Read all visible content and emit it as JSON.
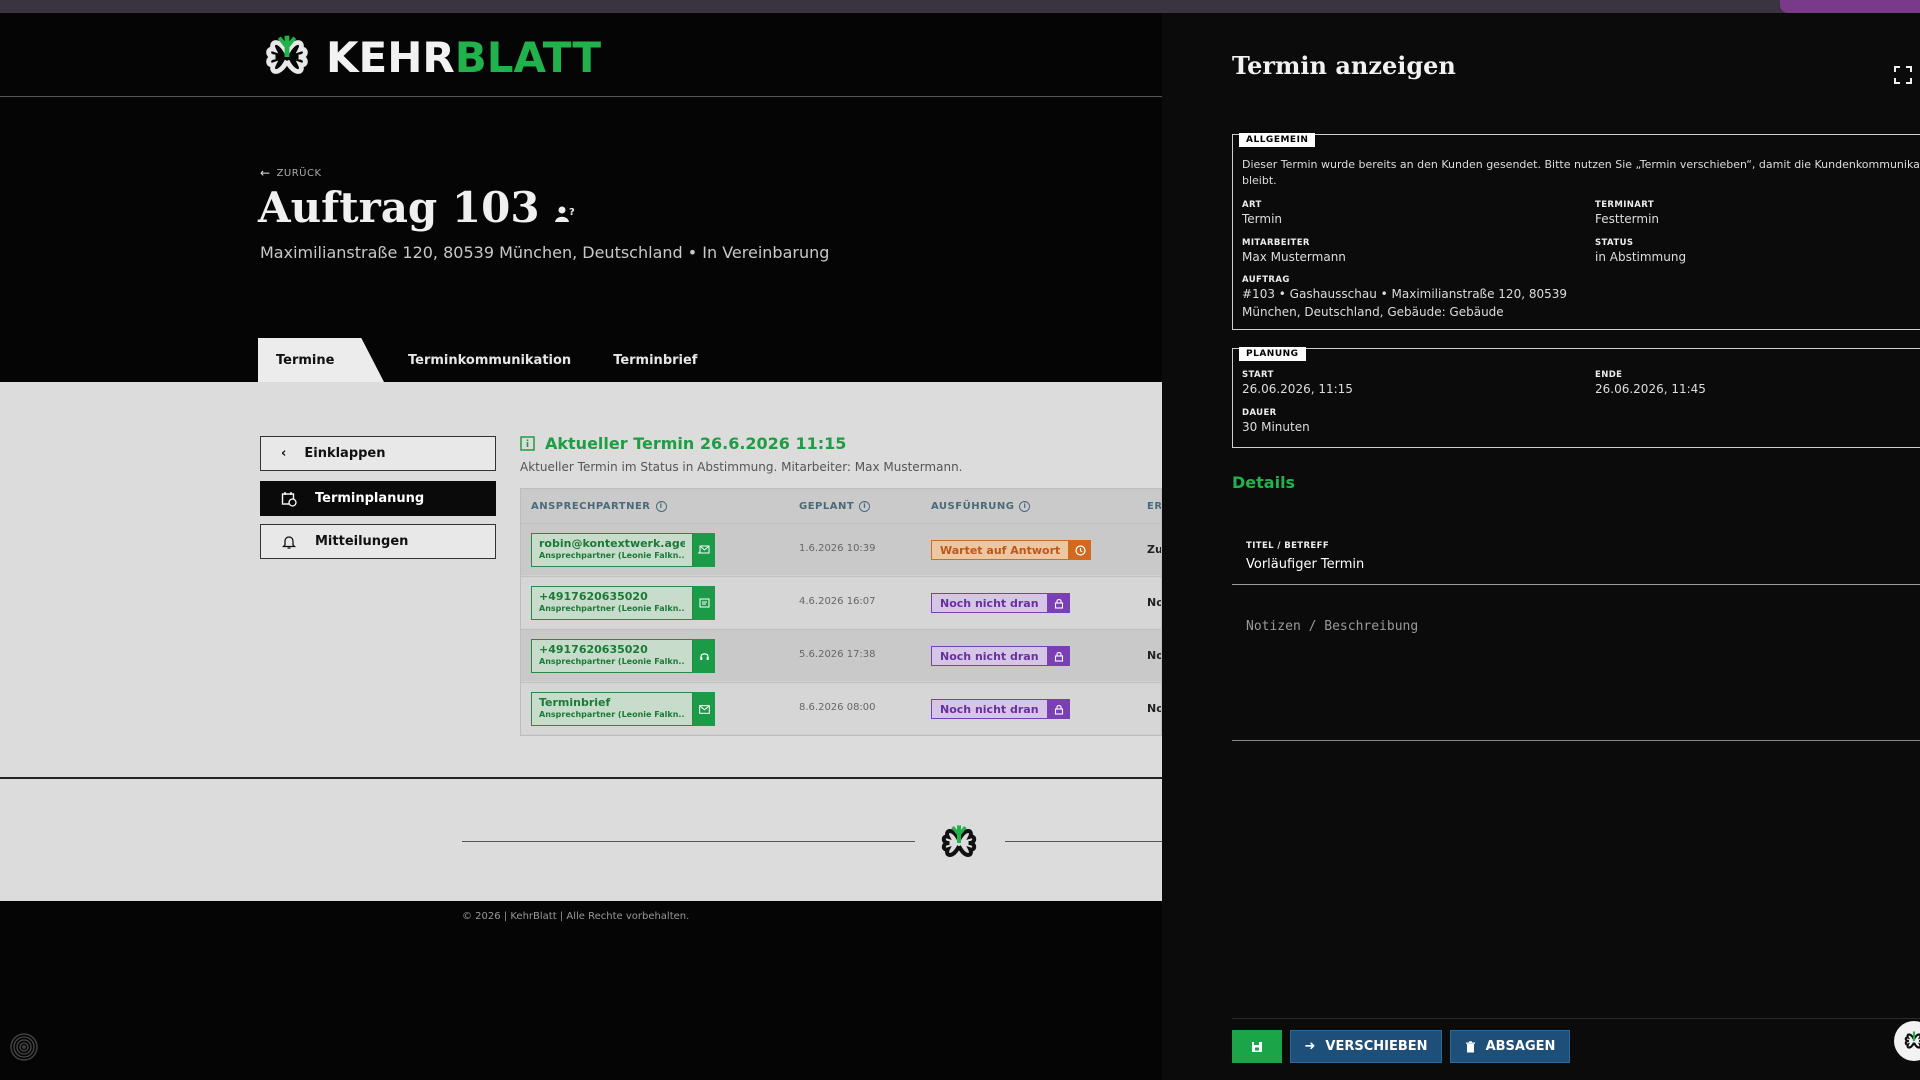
{
  "brand": {
    "name_part1": "KEHR",
    "name_part2": "BLATT",
    "color_light": "#f2f2f2",
    "color_green": "#22b24c"
  },
  "page": {
    "back_label": "ZURÜCK",
    "title": "Auftrag 103",
    "subtitle": "Maximilianstraße 120, 80539 München, Deutschland • In Vereinbarung"
  },
  "tabs": [
    {
      "label": "Termine",
      "active": true
    },
    {
      "label": "Terminkommunikation",
      "active": false
    },
    {
      "label": "Terminbrief",
      "active": false
    }
  ],
  "sidebar": {
    "collapse_label": "Einklappen",
    "planning_label": "Terminplanung",
    "messages_label": "Mitteilungen"
  },
  "current": {
    "heading": "Aktueller Termin 26.6.2026 11:15",
    "subtext": "Aktueller Termin im Status in Abstimmung. Mitarbeiter: Max Mustermann."
  },
  "table": {
    "headers": {
      "contact": "ANSPRECHPARTNER",
      "planned": "GEPLANT",
      "execution": "AUSFÜHRUNG",
      "result": "ER"
    },
    "rows": [
      {
        "contact": "robin@kontextwerk.agency",
        "contact_sub": "Ansprechpartner (Leonie Falkn...)",
        "icon": "email-send-icon",
        "planned": "1.6.2026 10:39",
        "status": "Wartet auf Antwort",
        "status_color": "orange",
        "status_icon": "clock-icon",
        "result": "Zu"
      },
      {
        "contact": "+4917620635020",
        "contact_sub": "Ansprechpartner (Leonie Falkn...)",
        "icon": "message-icon",
        "planned": "4.6.2026 16:07",
        "status": "Noch nicht dran",
        "status_color": "purple",
        "status_icon": "lock-icon",
        "result": "No"
      },
      {
        "contact": "+4917620635020",
        "contact_sub": "Ansprechpartner (Leonie Falkn...)",
        "icon": "headset-icon",
        "planned": "5.6.2026 17:38",
        "status": "Noch nicht dran",
        "status_color": "purple",
        "status_icon": "lock-icon",
        "result": "No"
      },
      {
        "contact": "Terminbrief",
        "contact_sub": "Ansprechpartner (Leonie Falkn...)",
        "icon": "mail-icon",
        "planned": "8.6.2026 08:00",
        "status": "Noch nicht dran",
        "status_color": "purple",
        "status_icon": "lock-icon",
        "result": "No"
      }
    ]
  },
  "footer": {
    "copyright": "© 2026 | KehrBlatt | Alle Rechte vorbehalten."
  },
  "panel": {
    "title": "Termin anzeigen",
    "general": {
      "label": "ALLGEMEIN",
      "note": "Dieser Termin wurde bereits an den Kunden gesendet. Bitte nutzen Sie „Termin verschieben“, damit die Kundenkommunikation saub",
      "note2": "bleibt.",
      "art_label": "ART",
      "art_value": "Termin",
      "terminart_label": "TERMINART",
      "terminart_value": "Festtermin",
      "mitarbeiter_label": "MITARBEITER",
      "mitarbeiter_value": "Max Mustermann",
      "status_label": "STATUS",
      "status_value": "in Abstimmung",
      "auftrag_label": "AUFTRAG",
      "auftrag_value1": "#103 • Gashausschau • Maximilianstraße 120, 80539",
      "auftrag_value2": "München, Deutschland, Gebäude: Gebäude"
    },
    "planning": {
      "label": "PLANUNG",
      "start_label": "START",
      "start_value": "26.06.2026, 11:15",
      "end_label": "ENDE",
      "end_value": "26.06.2026, 11:45",
      "duration_label": "DAUER",
      "duration_value": "30 Minuten"
    },
    "details_heading": "Details",
    "title_field_label": "TITEL / BETREFF",
    "title_field_value": "Vorläufiger Termin",
    "notes_placeholder": "Notizen / Beschreibung",
    "buttons": {
      "move": "VERSCHIEBEN",
      "cancel": "ABSAGEN"
    }
  }
}
